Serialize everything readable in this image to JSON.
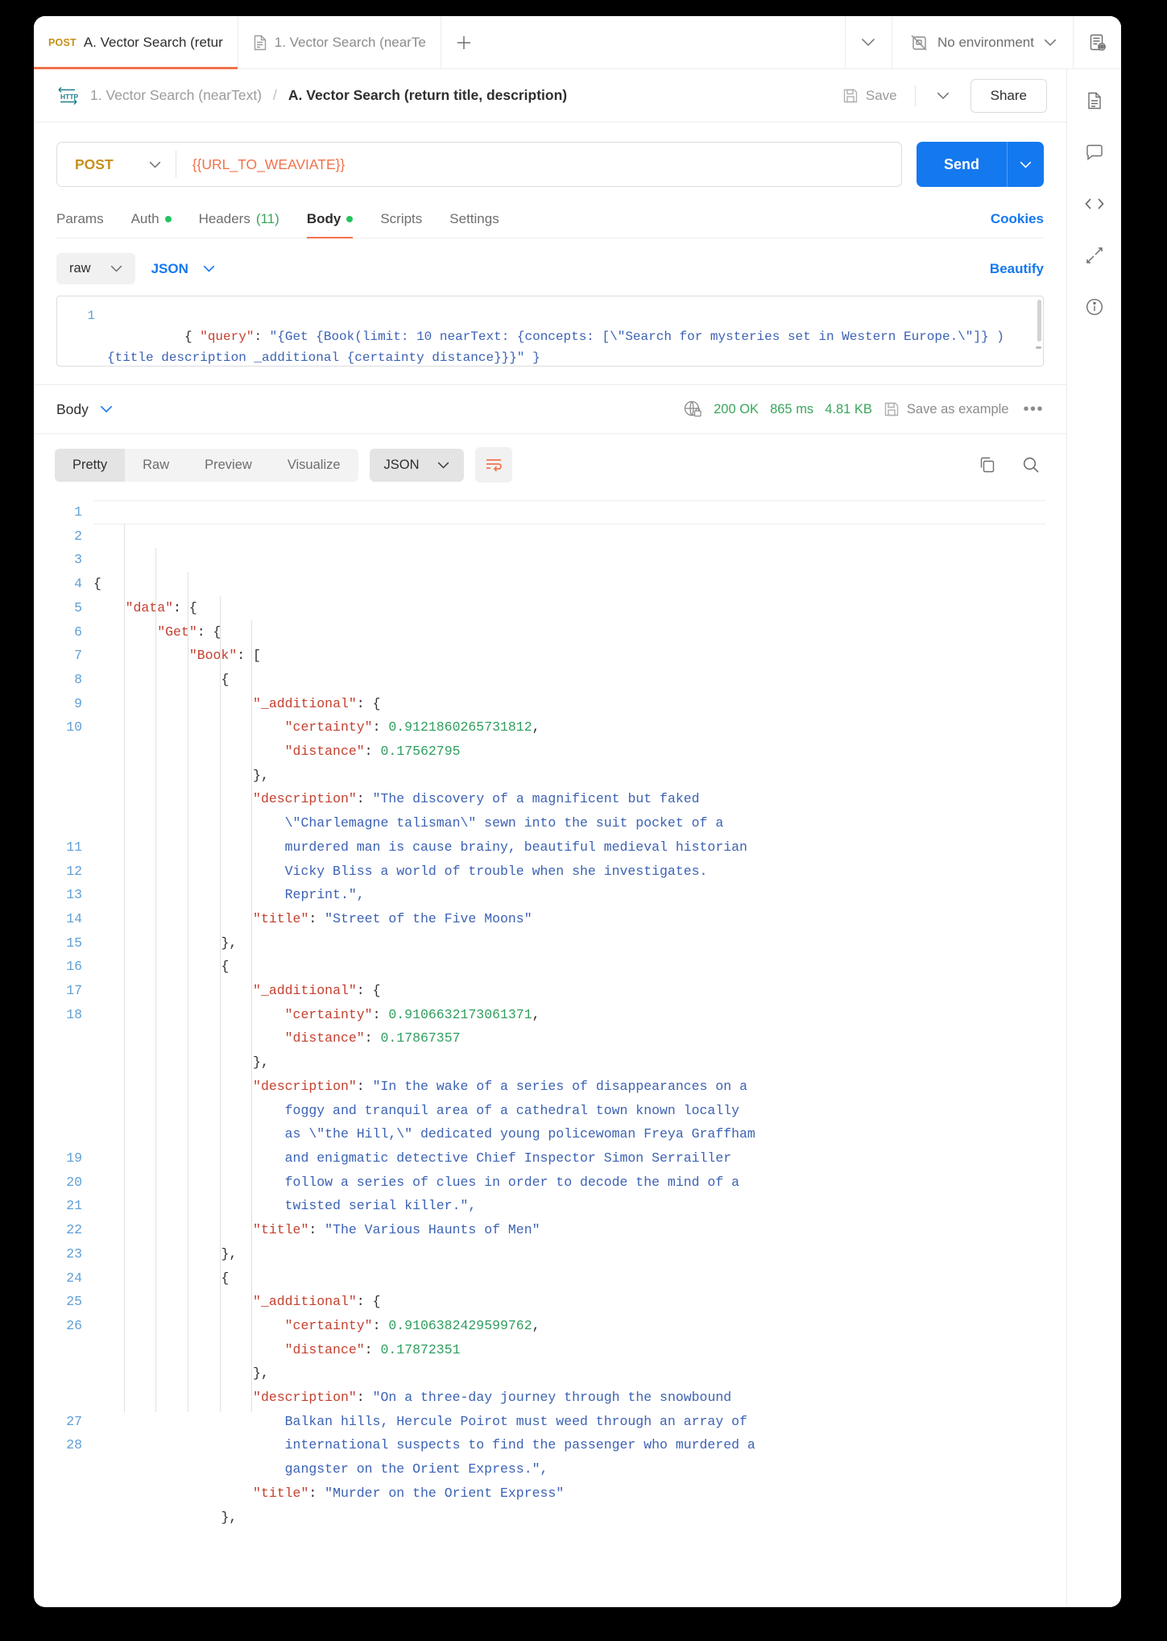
{
  "tabstrip": {
    "tabs": [
      {
        "method": "POST",
        "label": "A. Vector Search (retur",
        "icon": "method-label",
        "active": true
      },
      {
        "method": "",
        "label": "1. Vector Search (nearTe",
        "icon": "document-icon",
        "active": false
      }
    ],
    "new_tab_label": "+",
    "environment": {
      "label": "No environment",
      "icon": "no-environment-icon"
    }
  },
  "breadcrumb": {
    "protocol_badge": "HTTP",
    "parent": "1. Vector Search (nearText)",
    "separator": "/",
    "current": "A. Vector Search (return title, description)",
    "save_label": "Save",
    "share_label": "Share"
  },
  "request": {
    "method": "POST",
    "url": "{{URL_TO_WEAVIATE}}",
    "send_label": "Send",
    "tabs": [
      {
        "label": "Params",
        "badge": "",
        "dot": false,
        "active": false
      },
      {
        "label": "Auth",
        "badge": "",
        "dot": true,
        "active": false
      },
      {
        "label": "Headers",
        "badge": "(11)",
        "dot": false,
        "active": false
      },
      {
        "label": "Body",
        "badge": "",
        "dot": true,
        "active": true
      },
      {
        "label": "Scripts",
        "badge": "",
        "dot": false,
        "active": false
      },
      {
        "label": "Settings",
        "badge": "",
        "dot": false,
        "active": false
      }
    ],
    "cookies_label": "Cookies",
    "body_mode": "raw",
    "body_format": "JSON",
    "beautify_label": "Beautify",
    "editor": {
      "line_number": "1",
      "segment_open": "{ ",
      "segment_key": "\"query\"",
      "segment_colon": ": ",
      "segment_value": "\"{Get {Book(limit: 10 nearText: {concepts: [\\\"Search for mysteries set in Western Europe.\\\"]} ) {title description _additional {certainty distance}}}",
      "segment_tail": "\" }"
    }
  },
  "response": {
    "body_label": "Body",
    "status": "200 OK",
    "time": "865 ms",
    "size": "4.81 KB",
    "save_as_example": "Save as example",
    "more_label": "•••",
    "view_tabs": [
      "Pretty",
      "Raw",
      "Preview",
      "Visualize"
    ],
    "active_view_tab": "Pretty",
    "format": "JSON",
    "lines": [
      {
        "n": "1",
        "indent": 0,
        "parts": [
          {
            "t": "{",
            "c": "p"
          }
        ]
      },
      {
        "n": "2",
        "indent": 1,
        "parts": [
          {
            "t": "\"data\"",
            "c": "k"
          },
          {
            "t": ": {",
            "c": "p"
          }
        ]
      },
      {
        "n": "3",
        "indent": 2,
        "parts": [
          {
            "t": "\"Get\"",
            "c": "k"
          },
          {
            "t": ": {",
            "c": "p"
          }
        ]
      },
      {
        "n": "4",
        "indent": 3,
        "parts": [
          {
            "t": "\"Book\"",
            "c": "k"
          },
          {
            "t": ": [",
            "c": "p"
          }
        ]
      },
      {
        "n": "5",
        "indent": 4,
        "parts": [
          {
            "t": "{",
            "c": "p"
          }
        ]
      },
      {
        "n": "6",
        "indent": 5,
        "parts": [
          {
            "t": "\"_additional\"",
            "c": "k"
          },
          {
            "t": ": {",
            "c": "p"
          }
        ]
      },
      {
        "n": "7",
        "indent": 6,
        "parts": [
          {
            "t": "\"certainty\"",
            "c": "k"
          },
          {
            "t": ": ",
            "c": "p"
          },
          {
            "t": "0.9121860265731812",
            "c": "n"
          },
          {
            "t": ",",
            "c": "p"
          }
        ]
      },
      {
        "n": "8",
        "indent": 6,
        "parts": [
          {
            "t": "\"distance\"",
            "c": "k"
          },
          {
            "t": ": ",
            "c": "p"
          },
          {
            "t": "0.17562795",
            "c": "n"
          }
        ]
      },
      {
        "n": "9",
        "indent": 5,
        "parts": [
          {
            "t": "},",
            "c": "p"
          }
        ]
      },
      {
        "n": "10",
        "indent": 5,
        "parts": [
          {
            "t": "\"description\"",
            "c": "k"
          },
          {
            "t": ": ",
            "c": "p"
          },
          {
            "t": "\"The discovery of a magnificent but faked",
            "c": "s"
          }
        ],
        "cont": [
          "\\\"Charlemagne talisman\\\" sewn into the suit pocket of a",
          "murdered man is cause brainy, beautiful medieval historian",
          "Vicky Bliss a world of trouble when she investigates.",
          "Reprint.\","
        ]
      },
      {
        "n": "11",
        "indent": 5,
        "parts": [
          {
            "t": "\"title\"",
            "c": "k"
          },
          {
            "t": ": ",
            "c": "p"
          },
          {
            "t": "\"Street of the Five Moons\"",
            "c": "s"
          }
        ]
      },
      {
        "n": "12",
        "indent": 4,
        "parts": [
          {
            "t": "},",
            "c": "p"
          }
        ]
      },
      {
        "n": "13",
        "indent": 4,
        "parts": [
          {
            "t": "{",
            "c": "p"
          }
        ]
      },
      {
        "n": "14",
        "indent": 5,
        "parts": [
          {
            "t": "\"_additional\"",
            "c": "k"
          },
          {
            "t": ": {",
            "c": "p"
          }
        ]
      },
      {
        "n": "15",
        "indent": 6,
        "parts": [
          {
            "t": "\"certainty\"",
            "c": "k"
          },
          {
            "t": ": ",
            "c": "p"
          },
          {
            "t": "0.9106632173061371",
            "c": "n"
          },
          {
            "t": ",",
            "c": "p"
          }
        ]
      },
      {
        "n": "16",
        "indent": 6,
        "parts": [
          {
            "t": "\"distance\"",
            "c": "k"
          },
          {
            "t": ": ",
            "c": "p"
          },
          {
            "t": "0.17867357",
            "c": "n"
          }
        ]
      },
      {
        "n": "17",
        "indent": 5,
        "parts": [
          {
            "t": "},",
            "c": "p"
          }
        ]
      },
      {
        "n": "18",
        "indent": 5,
        "parts": [
          {
            "t": "\"description\"",
            "c": "k"
          },
          {
            "t": ": ",
            "c": "p"
          },
          {
            "t": "\"In the wake of a series of disappearances on a",
            "c": "s"
          }
        ],
        "cont": [
          "foggy and tranquil area of a cathedral town known locally",
          "as \\\"the Hill,\\\" dedicated young policewoman Freya Graffham",
          "and enigmatic detective Chief Inspector Simon Serrailler",
          "follow a series of clues in order to decode the mind of a",
          "twisted serial killer.\","
        ]
      },
      {
        "n": "19",
        "indent": 5,
        "parts": [
          {
            "t": "\"title\"",
            "c": "k"
          },
          {
            "t": ": ",
            "c": "p"
          },
          {
            "t": "\"The Various Haunts of Men\"",
            "c": "s"
          }
        ]
      },
      {
        "n": "20",
        "indent": 4,
        "parts": [
          {
            "t": "},",
            "c": "p"
          }
        ]
      },
      {
        "n": "21",
        "indent": 4,
        "parts": [
          {
            "t": "{",
            "c": "p"
          }
        ]
      },
      {
        "n": "22",
        "indent": 5,
        "parts": [
          {
            "t": "\"_additional\"",
            "c": "k"
          },
          {
            "t": ": {",
            "c": "p"
          }
        ]
      },
      {
        "n": "23",
        "indent": 6,
        "parts": [
          {
            "t": "\"certainty\"",
            "c": "k"
          },
          {
            "t": ": ",
            "c": "p"
          },
          {
            "t": "0.9106382429599762",
            "c": "n"
          },
          {
            "t": ",",
            "c": "p"
          }
        ]
      },
      {
        "n": "24",
        "indent": 6,
        "parts": [
          {
            "t": "\"distance\"",
            "c": "k"
          },
          {
            "t": ": ",
            "c": "p"
          },
          {
            "t": "0.17872351",
            "c": "n"
          }
        ]
      },
      {
        "n": "25",
        "indent": 5,
        "parts": [
          {
            "t": "},",
            "c": "p"
          }
        ]
      },
      {
        "n": "26",
        "indent": 5,
        "parts": [
          {
            "t": "\"description\"",
            "c": "k"
          },
          {
            "t": ": ",
            "c": "p"
          },
          {
            "t": "\"On a three-day journey through the snowbound",
            "c": "s"
          }
        ],
        "cont": [
          "Balkan hills, Hercule Poirot must weed through an array of",
          "international suspects to find the passenger who murdered a",
          "gangster on the Orient Express.\","
        ]
      },
      {
        "n": "27",
        "indent": 5,
        "parts": [
          {
            "t": "\"title\"",
            "c": "k"
          },
          {
            "t": ": ",
            "c": "p"
          },
          {
            "t": "\"Murder on the Orient Express\"",
            "c": "s"
          }
        ]
      },
      {
        "n": "28",
        "indent": 4,
        "parts": [
          {
            "t": "},",
            "c": "p"
          }
        ]
      }
    ]
  },
  "rail": {
    "icons": [
      "collection-doc-icon",
      "comment-icon",
      "code-icon",
      "fork-icon",
      "info-icon"
    ]
  },
  "colors": {
    "accent": "#f2724b",
    "send": "#1478ef",
    "success": "#3aa55c",
    "method": "#c79019",
    "string": "#3c62b4",
    "key": "#c5402f",
    "number": "#2f9e5e"
  }
}
